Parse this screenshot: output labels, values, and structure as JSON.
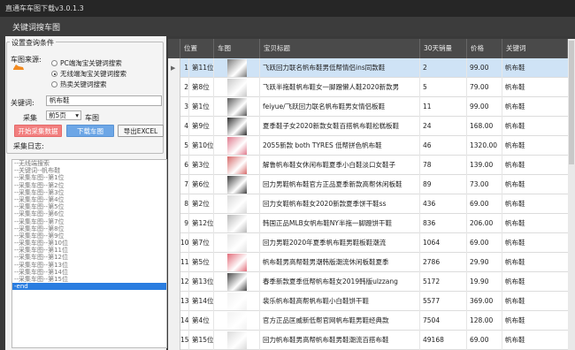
{
  "window": {
    "title": "直通车车图下载v3.0.1.3",
    "tab": "关键词搜车图"
  },
  "left": {
    "group_title": "设置查询条件",
    "source_label": "车图来源:",
    "radio_options": [
      {
        "label": "PC端淘宝关键词搜索",
        "selected": false
      },
      {
        "label": "无线端淘宝关键词搜索",
        "selected": true
      },
      {
        "label": "热卖关键词搜索",
        "selected": false
      }
    ],
    "keyword_label": "关键词:",
    "keyword_value": "帆布鞋",
    "collect_label": "采集",
    "collect_select": "前5页",
    "collect_suffix": "车图",
    "btn_start": "开始采集数据",
    "btn_download": "下载车图",
    "btn_export": "导出EXCEL",
    "log_title": "采集日志:",
    "log_lines": [
      "--无线端搜索",
      "--关键词--帆布鞋",
      "--采集车图--第1位",
      "--采集车图--第2位",
      "--采集车图--第3位",
      "--采集车图--第4位",
      "--采集车图--第5位",
      "--采集车图--第6位",
      "--采集车图--第7位",
      "--采集车图--第8位",
      "--采集车图--第9位",
      "--采集车图--第10位",
      "--采集车图--第11位",
      "--采集车图--第12位",
      "--采集车图--第13位",
      "--采集车图--第14位",
      "--采集车图--第15位",
      "-end"
    ]
  },
  "table": {
    "headers": [
      "位置",
      "车图",
      "宝贝标题",
      "30天销量",
      "价格",
      "关键词"
    ],
    "rows": [
      {
        "idx": "1",
        "pos": "第11位",
        "title": "飞跃回力联名帆布鞋男低帮情侣ins同款鞋",
        "sales": "2",
        "price": "99.00",
        "kw": "帆布鞋",
        "c": "#7a7a7a"
      },
      {
        "idx": "2",
        "pos": "第8位",
        "title": "飞跃半拖鞋帆布鞋女一脚蹬懒人鞋2020新款男",
        "sales": "5",
        "price": "79.00",
        "kw": "帆布鞋",
        "c": "#c9c9c9"
      },
      {
        "idx": "3",
        "pos": "第1位",
        "title": "feiyue/飞跃回力联名帆布鞋男女情侣板鞋",
        "sales": "11",
        "price": "99.00",
        "kw": "帆布鞋",
        "c": "#5b5b5b"
      },
      {
        "idx": "4",
        "pos": "第9位",
        "title": "夏季鞋子女2020新款女鞋百搭帆布鞋松糕板鞋",
        "sales": "24",
        "price": "168.00",
        "kw": "帆布鞋",
        "c": "#2f2f2f"
      },
      {
        "idx": "5",
        "pos": "第10位",
        "title": "2055新款 both TYRES 低帮拼色帆布鞋",
        "sales": "46",
        "price": "1320.00",
        "kw": "帆布鞋",
        "c": "#e07b8e"
      },
      {
        "idx": "6",
        "pos": "第3位",
        "title": "解鲁帆布鞋女休闲布鞋夏季小白鞋淡口女鞋子",
        "sales": "78",
        "price": "139.00",
        "kw": "帆布鞋",
        "c": "#d66a6a"
      },
      {
        "idx": "7",
        "pos": "第6位",
        "title": "回力男鞋帆布鞋官方正品夏季新款高帮休闲板鞋",
        "sales": "89",
        "price": "73.00",
        "kw": "帆布鞋",
        "c": "#3f3f3f"
      },
      {
        "idx": "8",
        "pos": "第2位",
        "title": "回力女鞋帆布鞋女2020新款夏季饼干鞋ss",
        "sales": "436",
        "price": "69.00",
        "kw": "帆布鞋",
        "c": "#d9d9d9"
      },
      {
        "idx": "9",
        "pos": "第12位",
        "title": "韩国正品MLB女帆布鞋NY半拖一脚蹬饼干鞋",
        "sales": "836",
        "price": "206.00",
        "kw": "帆布鞋",
        "c": "#b8b8b8"
      },
      {
        "idx": "10",
        "pos": "第7位",
        "title": "回力男鞋2020年夏季帆布鞋男鞋板鞋潮流",
        "sales": "1064",
        "price": "69.00",
        "kw": "帆布鞋",
        "c": "#e4e4e4"
      },
      {
        "idx": "11",
        "pos": "第5位",
        "title": "帆布鞋男高帮鞋男潮韩版潮流休闲板鞋夏季",
        "sales": "2786",
        "price": "29.90",
        "kw": "帆布鞋",
        "c": "#e26d7a"
      },
      {
        "idx": "12",
        "pos": "第13位",
        "title": "春季新款夏季低帮帆布鞋女2019韩版ulzzang",
        "sales": "5172",
        "price": "19.90",
        "kw": "帆布鞋",
        "c": "#4a4a4a"
      },
      {
        "idx": "13",
        "pos": "第14位",
        "title": "裴乐帆布鞋高帮帆布鞋小白鞋饼干鞋",
        "sales": "5577",
        "price": "369.00",
        "kw": "帆布鞋",
        "c": "#f1f1f1"
      },
      {
        "idx": "14",
        "pos": "第4位",
        "title": "官方正品匡威新低帮官网帆布鞋男鞋经典款",
        "sales": "7504",
        "price": "128.00",
        "kw": "帆布鞋",
        "c": "#f2f2f2"
      },
      {
        "idx": "15",
        "pos": "第15位",
        "title": "回力帆布鞋男高帮帆布鞋男鞋潮流百搭布鞋",
        "sales": "49168",
        "price": "69.00",
        "kw": "帆布鞋",
        "c": "#dcdcdc"
      }
    ]
  }
}
